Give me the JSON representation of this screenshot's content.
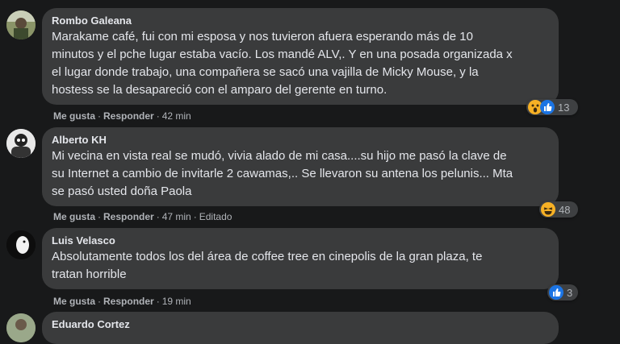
{
  "colors": {
    "background": "#18191a",
    "bubble": "#3a3b3c",
    "text": "#e4e6eb",
    "secondary": "#b0b3b8",
    "like": "#1b74e4",
    "haha": "#f7b125"
  },
  "actions": {
    "like": "Me gusta",
    "reply": "Responder",
    "separator": "·"
  },
  "comments": [
    {
      "author": "Rombo Galeana",
      "lines": [
        "Marakame café, fui con mi esposa y nos tuvieron afuera esperando más de 10",
        "minutos y el pche lugar estaba vacío. Los mandé ALV,. Y en una posada organizada x",
        "el lugar donde trabajo, una compañera se sacó una vajilla de Micky Mouse, y la",
        "hostess se la desapareció con el amparo del gerente en turno."
      ],
      "time": "42 min",
      "edited": "",
      "reactions": [
        "wow-icon",
        "like-icon"
      ],
      "reaction_count": "13"
    },
    {
      "author": "Alberto KH",
      "lines": [
        "Mi vecina en vista real se mudó, vivia alado de mi casa....su hijo me pasó la clave de",
        "su Internet a cambio de invitarle 2 cawamas,.. Se llevaron su antena los pelunis... Mta",
        "se pasó usted doña Paola"
      ],
      "time": "47 min",
      "edited": "Editado",
      "reactions": [
        "haha-icon"
      ],
      "reaction_count": "48"
    },
    {
      "author": "Luis Velasco",
      "lines": [
        "Absolutamente todos los del área de coffee tree en cinepolis de la gran plaza, te",
        "tratan horrible"
      ],
      "time": "19 min",
      "edited": "",
      "reactions": [
        "like-icon"
      ],
      "reaction_count": "3"
    },
    {
      "author": "Eduardo Cortez",
      "lines": [],
      "time": "",
      "edited": "",
      "reactions": [],
      "reaction_count": ""
    }
  ]
}
